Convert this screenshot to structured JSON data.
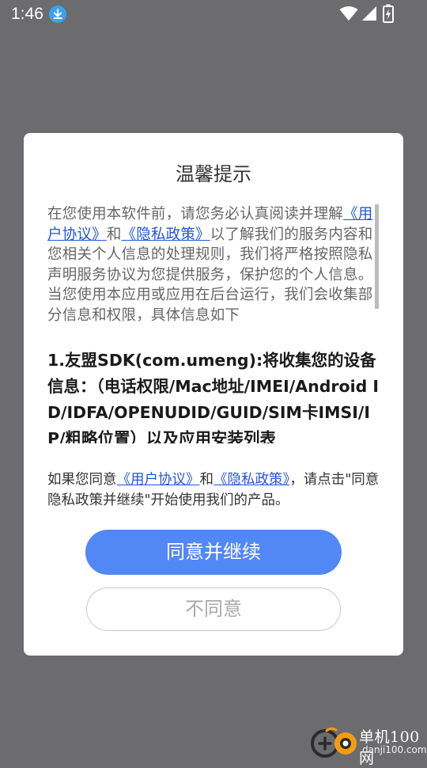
{
  "status_bar": {
    "time": "1:46",
    "icons": [
      "download-icon",
      "wifi-icon",
      "signal-icon",
      "battery-charging-icon"
    ]
  },
  "dialog": {
    "title": "温馨提示",
    "intro": {
      "text_before": "在您使用本软件前，请您务必认真阅读并理解",
      "link_user_agreement": "《用户协议》",
      "and": "和",
      "link_privacy_policy": "《隐私政策》",
      "text_after": "以了解我们的服务内容和您相关个人信息的处理规则，我们将严格按照隐私声明服务协议为您提供服务，保护您的个人信息。当您使用本应用或应用在后台运行，我们会收集部分信息和权限，具体信息如下"
    },
    "section_1": "1.友盟SDK(com.umeng):将收集您的设备信息：（电话权限/Mac地址/IMEI/Android ID/IDFA/OPENUDID/GUID/SIM卡IMSI/IP/粗略位置）以及应用安装列表",
    "bottom": {
      "text_before": "如果您同意",
      "link_user_agreement": "《用户协议》",
      "and": "和",
      "link_privacy_policy": "《隐私政策》",
      "text_after": "，请点击\"同意隐私政策并继续\"开始使用我们的产品。"
    },
    "agree_button": "同意并继续",
    "disagree_button": "不同意"
  },
  "watermark": {
    "name": "单机100网",
    "url": "danji100.com"
  },
  "colors": {
    "overlay": "#6c6b6d",
    "link": "#2255d8",
    "agree_button": "#5287f6",
    "download_badge": "#3aa3f0"
  }
}
